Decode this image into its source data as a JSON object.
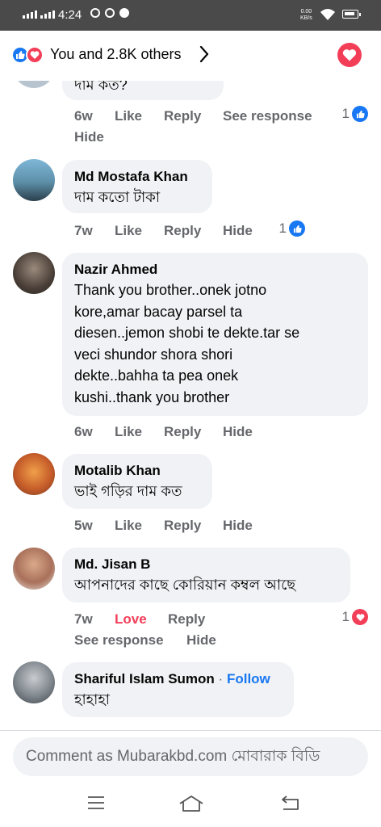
{
  "status_bar": {
    "time": "4:24",
    "net_speed_value": "0.00",
    "net_speed_unit": "KB/s"
  },
  "header": {
    "reactors_text": "You and 2.8K others"
  },
  "comments": [
    {
      "text": "দাম কত?",
      "time": "6w",
      "like": "Like",
      "reply": "Reply",
      "extra": "See response",
      "hide": "Hide",
      "reaction_count": "1",
      "reaction_type": "like-icon"
    },
    {
      "name": "Md Mostafa Khan",
      "text": "দাম কতো টাকা",
      "time": "7w",
      "like": "Like",
      "reply": "Reply",
      "hide": "Hide",
      "reaction_count": "1",
      "reaction_type": "like-icon"
    },
    {
      "name": "Nazir Ahmed",
      "text_lines": [
        "Thank you brother..onek jotno",
        "kore,amar bacay parsel ta",
        "diesen..jemon shobi te dekte.tar se",
        "veci shundor shora shori",
        "dekte..bahha ta pea onek",
        "kushi..thank you brother"
      ],
      "time": "6w",
      "like": "Like",
      "reply": "Reply",
      "hide": "Hide"
    },
    {
      "name": "Motalib Khan",
      "text": "ভাই গড়ির দাম কত",
      "time": "5w",
      "like": "Like",
      "reply": "Reply",
      "hide": "Hide"
    },
    {
      "name": "Md. Jisan B",
      "text": "আপনাদের কাছে কোরিয়ান কম্বল আছে",
      "time": "7w",
      "like": "Love",
      "reply": "Reply",
      "see_response": "See response",
      "hide": "Hide",
      "reaction_count": "1",
      "reaction_type": "love-icon"
    },
    {
      "name": "Shariful Islam Sumon",
      "separator": "·",
      "follow": "Follow",
      "text": "হাহাহা"
    }
  ],
  "composer": {
    "placeholder": "Comment as Mubarakbd.com মোবারাক বিডি"
  },
  "colors": {
    "facebook_blue": "#1877f2",
    "love_red": "#f33e58",
    "bubble_gray": "#f0f2f5",
    "secondary_text": "#65676b"
  }
}
